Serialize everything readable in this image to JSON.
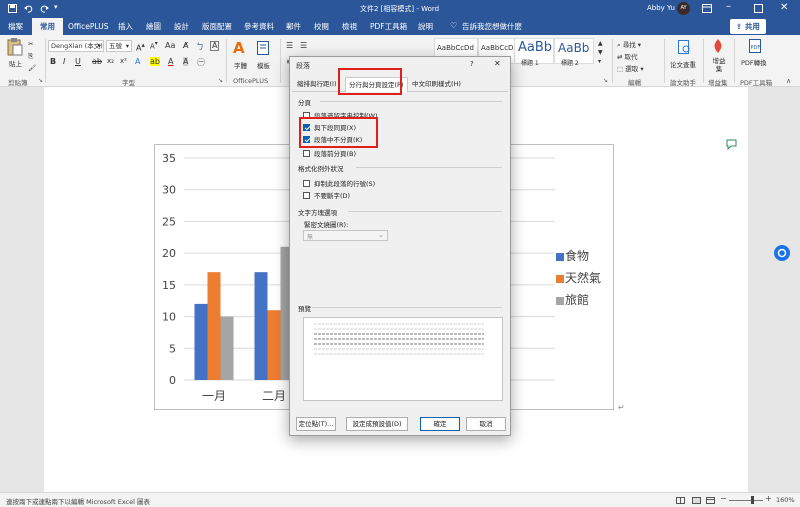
{
  "title_bar": {
    "doc_title": "文件2 [相容模式] - Word",
    "user_name": "Abby Yu",
    "avatar_label": "AY"
  },
  "tabs": [
    "檔案",
    "常用",
    "OfficePLUS",
    "插入",
    "繪圖",
    "設計",
    "版面配置",
    "參考資料",
    "郵件",
    "校閱",
    "檢視",
    "PDF工具箱",
    "說明"
  ],
  "tell_me": "告訴我您想做什麼",
  "share": "共用",
  "ribbon": {
    "paste": "貼上",
    "clipboard": "剪貼簿",
    "font_name": "DengXian (本文)",
    "font_size": "五號",
    "font_group": "字型",
    "font_btn": "字體",
    "template_btn": "模板",
    "officeplus_group": "OfficePLUS",
    "style_samples": [
      "AaBbCcDd",
      "AaBbCcDd",
      "AaBb",
      "AaBb"
    ],
    "style_names": [
      "",
      "",
      "標題 1",
      "標題 2"
    ],
    "find": "尋找",
    "replace": "取代",
    "select": "選取",
    "edit_group": "編輯",
    "paper_check": "论文查重",
    "paper_group": "論文助手",
    "addin": "增益集",
    "addin_group": "增益集",
    "pdf_convert": "PDF轉換",
    "pdf_group": "PDF工具箱"
  },
  "dialog": {
    "title": "段落",
    "help": "?",
    "tabs": [
      "縮排與行距(I)",
      "分行與分頁設定(P)",
      "中文印刷樣式(H)"
    ],
    "pagination": "分頁",
    "cb_widow": "段落遺留字串控制(W)",
    "cb_keep_next": "與下段同頁(X)",
    "cb_keep_lines": "段落中不分頁(K)",
    "cb_page_before": "段落前分頁(B)",
    "formatting_exceptions": "格式化例外狀況",
    "cb_suppress": "抑制此段落的行號(S)",
    "cb_no_hyphen": "不要斷字(D)",
    "textbox_options": "文字方塊選項",
    "tight_wrap": "緊密文繞圖(R):",
    "tight_wrap_value": "無",
    "preview": "預覽",
    "btn_tabs": "定位點(T)...",
    "btn_default": "設定成預設值(D)",
    "btn_ok": "確定",
    "btn_cancel": "取消"
  },
  "status_text": "連按兩下或連點兩下以編輯 Microsoft Excel 圖表",
  "zoom": "160%",
  "colors": {
    "food": "#4472c4",
    "gas": "#ed7d31",
    "hotel": "#a5a5a5",
    "accent": "#2b579a",
    "highlight": "#e0201b"
  },
  "chart_data": {
    "type": "bar",
    "categories": [
      "一月",
      "二月"
    ],
    "series": [
      {
        "name": "食物",
        "values": [
          12,
          17
        ]
      },
      {
        "name": "天然氣",
        "values": [
          17,
          11
        ]
      },
      {
        "name": "旅館",
        "values": [
          10,
          21
        ]
      }
    ],
    "ylim": [
      0,
      35
    ],
    "yticks": [
      "35",
      "30",
      "25",
      "20",
      "15",
      "10",
      "5",
      "0"
    ],
    "legend_position": "right"
  }
}
